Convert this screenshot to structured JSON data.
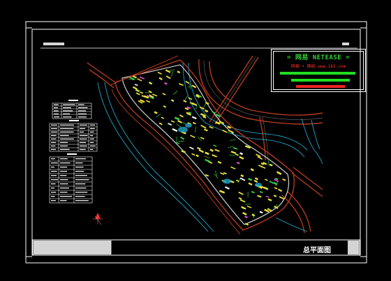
{
  "drawing": {
    "title_block_label": "总平面图"
  },
  "watermark": {
    "title": "= 网易 NETEASE =",
    "subtitle": "网易 • 图纸   www.163.com",
    "bar_colors": [
      "#22dd22",
      "#22dd22",
      "#ee2222"
    ]
  },
  "colors": {
    "background": "#000000",
    "frame": "#ffffff",
    "road": "#b33a1f",
    "building": "#e6e03a",
    "green": "#2fcf4a",
    "water": "#1fa6c9",
    "title_block_fill": "#d4d4d4"
  }
}
